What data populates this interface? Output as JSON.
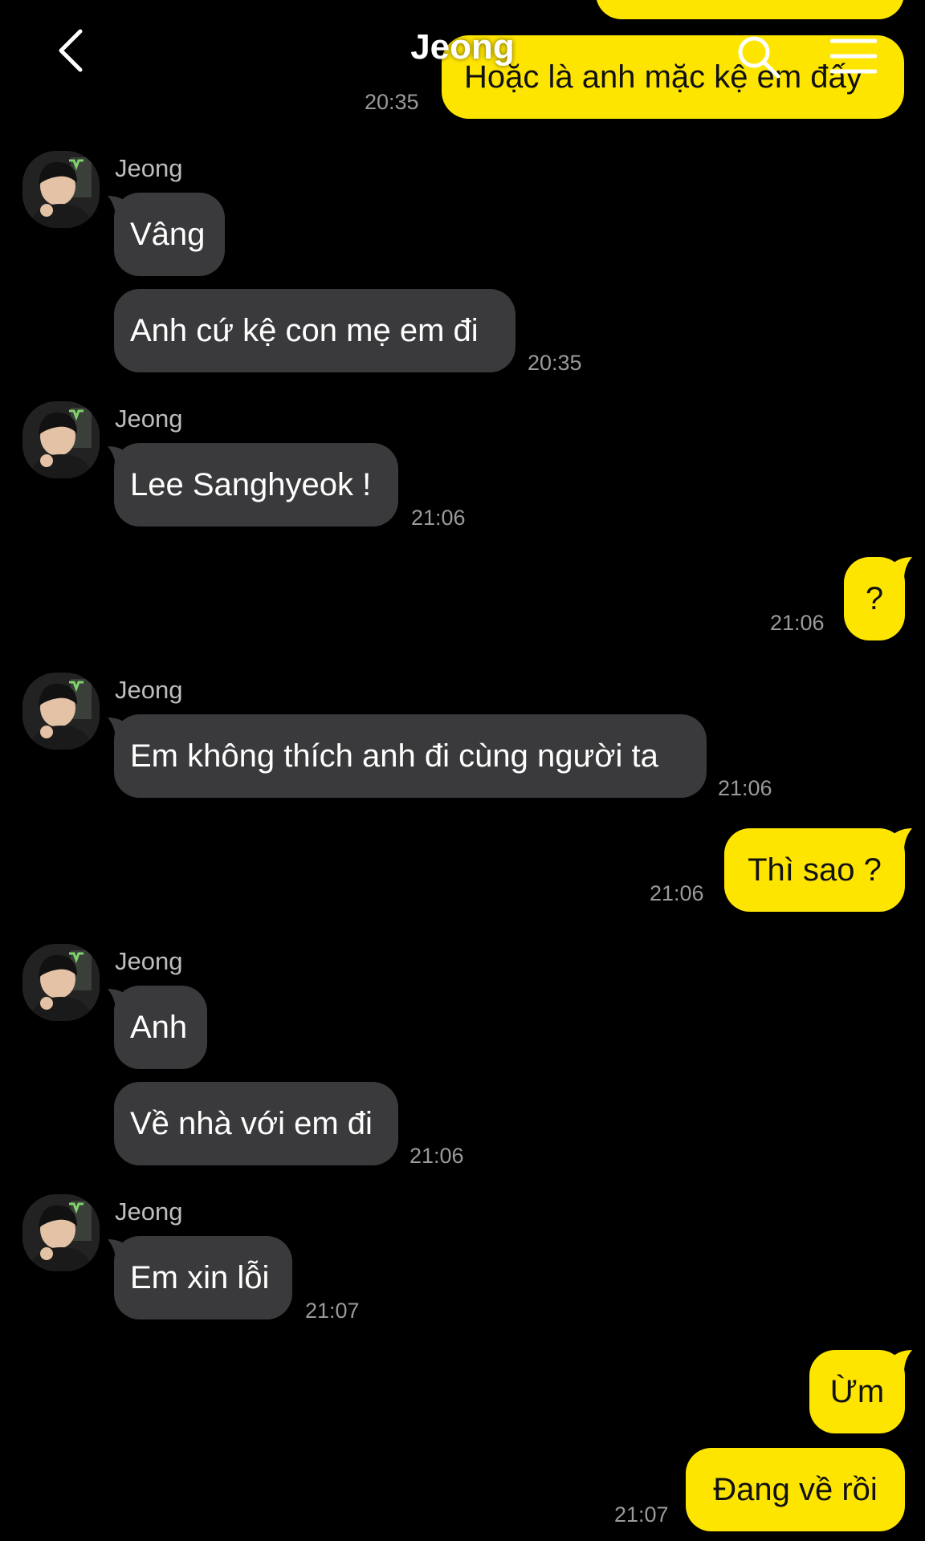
{
  "header": {
    "title": "Jeong",
    "back_icon": "chevron-left-icon",
    "search_icon": "search-icon",
    "menu_icon": "hamburger-menu-icon"
  },
  "colors": {
    "background": "#000000",
    "incoming_bubble": "#3a3a3c",
    "outgoing_bubble": "#fee500",
    "timestamp": "#9a9a9a"
  },
  "chat": {
    "top_partial": {
      "text": "Hoặc là anh mặc kệ em đấy",
      "time": "20:35"
    },
    "groups": [
      {
        "sender": "Jeong",
        "messages": [
          "Vâng",
          "Anh cứ kệ con mẹ em đi"
        ],
        "time": "20:35"
      },
      {
        "sender": "Jeong",
        "messages": [
          "Lee Sanghyeok !"
        ],
        "time": "21:06"
      },
      {
        "outgoing": true,
        "messages": [
          "?"
        ],
        "time": "21:06"
      },
      {
        "sender": "Jeong",
        "messages": [
          "Em không thích anh đi cùng người ta"
        ],
        "time": "21:06"
      },
      {
        "outgoing": true,
        "messages": [
          "Thì sao ?"
        ],
        "time": "21:06"
      },
      {
        "sender": "Jeong",
        "messages": [
          "Anh",
          "Về nhà với em đi"
        ],
        "time": "21:06"
      },
      {
        "sender": "Jeong",
        "messages": [
          "Em xin lỗi"
        ],
        "time": "21:07"
      },
      {
        "outgoing": true,
        "messages": [
          "Ừm",
          "Đang về rồi"
        ],
        "time": "21:07"
      }
    ]
  }
}
